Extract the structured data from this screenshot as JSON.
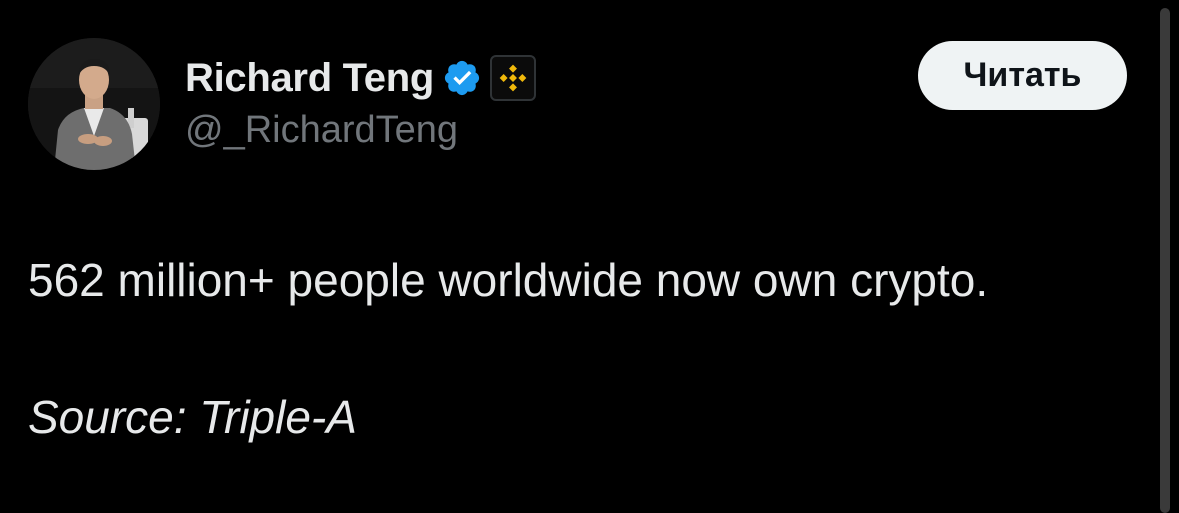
{
  "tweet": {
    "author": {
      "display_name": "Richard Teng",
      "handle": "@_RichardTeng",
      "verified_icon": "verified-checkmark-icon",
      "affiliate_icon": "binance-logo-icon"
    },
    "follow_button_label": "Читать",
    "text": "562 million+ people worldwide now own crypto.",
    "source_line": "Source: Triple-A"
  },
  "colors": {
    "background": "#000000",
    "primary_text": "#e7e9ea",
    "secondary_text": "#71767b",
    "verified_blue": "#1d9bf0",
    "binance_yellow": "#f0b90b",
    "button_bg": "#eff3f4",
    "button_text": "#0f1419"
  }
}
